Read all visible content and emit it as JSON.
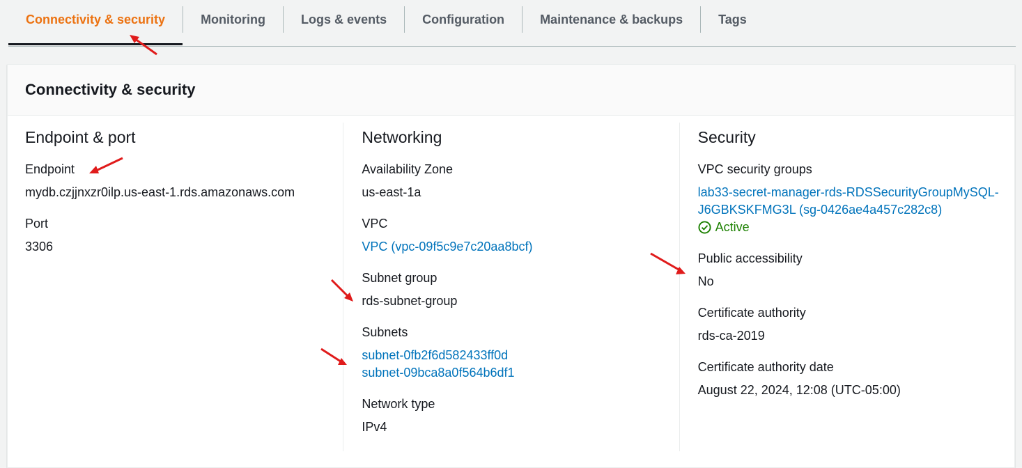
{
  "tabs": [
    {
      "label": "Connectivity & security",
      "active": true
    },
    {
      "label": "Monitoring"
    },
    {
      "label": "Logs & events"
    },
    {
      "label": "Configuration"
    },
    {
      "label": "Maintenance & backups"
    },
    {
      "label": "Tags"
    }
  ],
  "panel": {
    "title": "Connectivity & security",
    "endpoint_port": {
      "title": "Endpoint & port",
      "endpoint_label": "Endpoint",
      "endpoint_value": "mydb.czjjnxzr0ilp.us-east-1.rds.amazonaws.com",
      "port_label": "Port",
      "port_value": "3306"
    },
    "networking": {
      "title": "Networking",
      "az_label": "Availability Zone",
      "az_value": "us-east-1a",
      "vpc_label": "VPC",
      "vpc_value": "VPC (vpc-09f5c9e7c20aa8bcf)",
      "subnet_group_label": "Subnet group",
      "subnet_group_value": "rds-subnet-group",
      "subnets_label": "Subnets",
      "subnets": [
        "subnet-0fb2f6d582433ff0d",
        "subnet-09bca8a0f564b6df1"
      ],
      "network_type_label": "Network type",
      "network_type_value": "IPv4"
    },
    "security": {
      "title": "Security",
      "sg_label": "VPC security groups",
      "sg_line1": "lab33-secret-manager-rds-RDSSecurityGroupMySQL-",
      "sg_line2": "J6GBKSKFMG3L (sg-0426ae4a457c282c8)",
      "sg_status": "Active",
      "public_label": "Public accessibility",
      "public_value": "No",
      "ca_label": "Certificate authority",
      "ca_value": "rds-ca-2019",
      "ca_date_label": "Certificate authority date",
      "ca_date_value": "August 22, 2024, 12:08 (UTC-05:00)"
    }
  },
  "colors": {
    "accent": "#ec7211",
    "link": "#0073bb",
    "success": "#1d8102",
    "annotation": "#e01b1b"
  },
  "icons": {
    "status": "check-circle-icon",
    "annotation": "red-arrow-icon"
  }
}
